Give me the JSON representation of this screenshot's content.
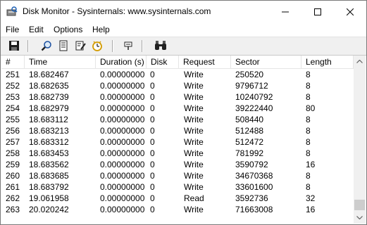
{
  "window": {
    "title": "Disk Monitor - Sysinternals: www.sysinternals.com"
  },
  "menu": [
    "File",
    "Edit",
    "Options",
    "Help"
  ],
  "toolbar": {
    "icons": [
      "save-icon",
      "magnifier-icon",
      "filter-icon",
      "highlight-icon",
      "clock-icon",
      "capture-icon",
      "find-icon"
    ]
  },
  "table": {
    "columns": [
      "#",
      "Time",
      "Duration (s)",
      "Disk",
      "Request",
      "Sector",
      "Length"
    ],
    "rows": [
      [
        "251",
        "18.682467",
        "0.00000000",
        "0",
        "Write",
        "250520",
        "8"
      ],
      [
        "252",
        "18.682635",
        "0.00000000",
        "0",
        "Write",
        "9796712",
        "8"
      ],
      [
        "253",
        "18.682739",
        "0.00000000",
        "0",
        "Write",
        "10240792",
        "8"
      ],
      [
        "254",
        "18.682979",
        "0.00000000",
        "0",
        "Write",
        "39222440",
        "80"
      ],
      [
        "255",
        "18.683112",
        "0.00000000",
        "0",
        "Write",
        "508440",
        "8"
      ],
      [
        "256",
        "18.683213",
        "0.00000000",
        "0",
        "Write",
        "512488",
        "8"
      ],
      [
        "257",
        "18.683312",
        "0.00000000",
        "0",
        "Write",
        "512472",
        "8"
      ],
      [
        "258",
        "18.683453",
        "0.00000000",
        "0",
        "Write",
        "781992",
        "8"
      ],
      [
        "259",
        "18.683562",
        "0.00000000",
        "0",
        "Write",
        "3590792",
        "16"
      ],
      [
        "260",
        "18.683685",
        "0.00000000",
        "0",
        "Write",
        "34670368",
        "8"
      ],
      [
        "261",
        "18.683792",
        "0.00000000",
        "0",
        "Write",
        "33601600",
        "8"
      ],
      [
        "262",
        "19.061958",
        "0.00000000",
        "0",
        "Read",
        "3592736",
        "32"
      ],
      [
        "263",
        "20.020242",
        "0.00000000",
        "0",
        "Write",
        "71663008",
        "16"
      ]
    ]
  }
}
